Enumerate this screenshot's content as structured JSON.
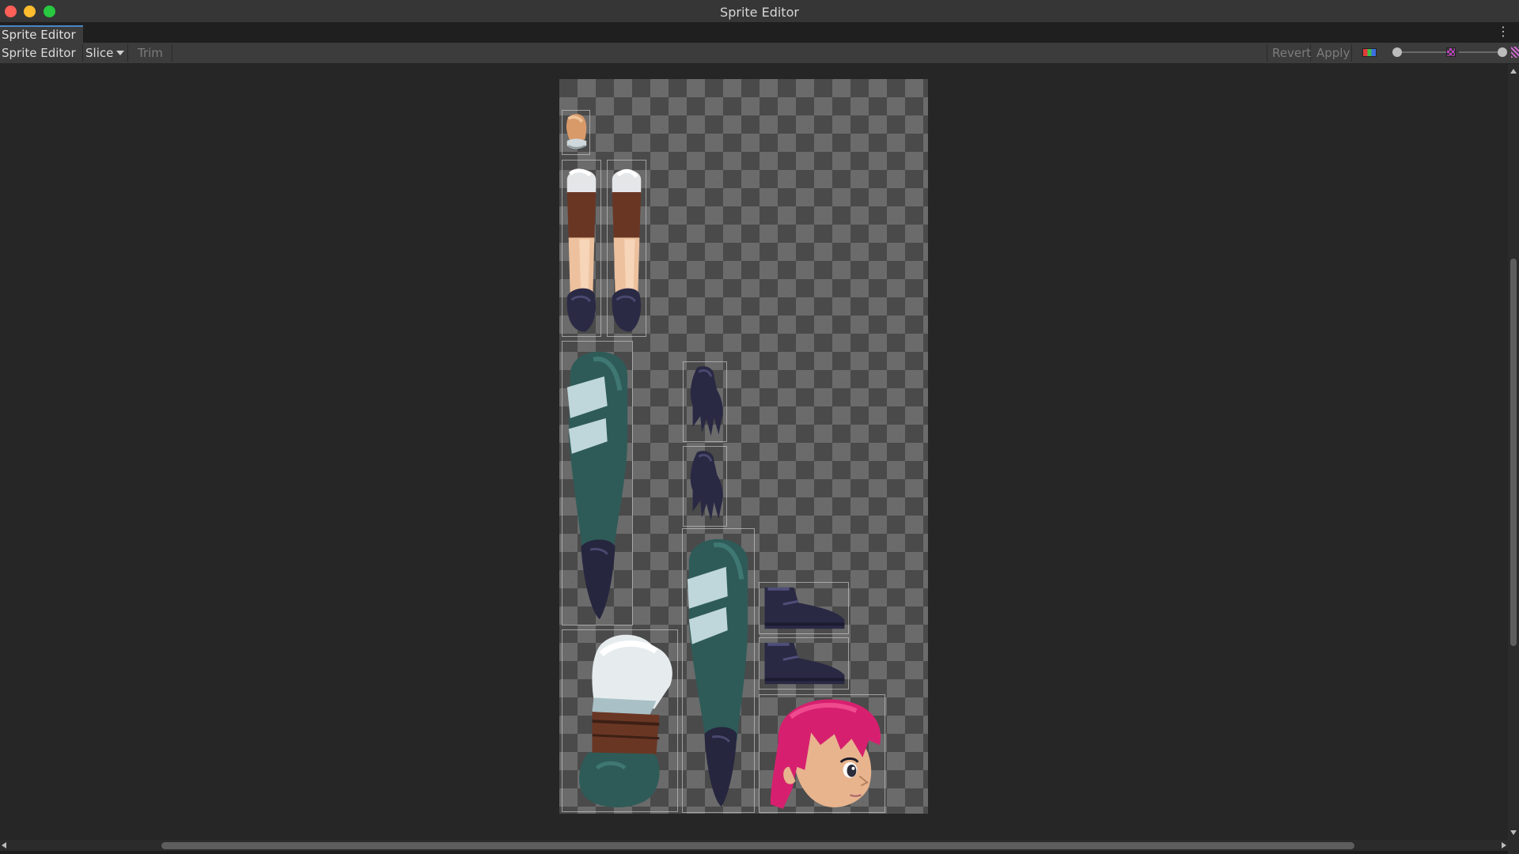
{
  "window": {
    "title": "Sprite Editor",
    "controls": [
      "close-icon",
      "minimize-icon",
      "zoom-icon"
    ]
  },
  "tab": {
    "label": "Sprite Editor",
    "menu_icon": "⋮"
  },
  "toolbar": {
    "mode_dropdown": "Sprite Editor",
    "slice_dropdown": "Slice",
    "trim_label": "Trim",
    "revert_label": "Revert",
    "apply_label": "Apply",
    "icons": [
      "color-channel-icon",
      "mip-level-icon",
      "alpha-toggle-icon"
    ]
  },
  "texture": {
    "background": "checkerboard",
    "sprites": [
      {
        "part": "hand-top"
      },
      {
        "part": "leg-left"
      },
      {
        "part": "leg-right"
      },
      {
        "part": "arm-long-left"
      },
      {
        "part": "glove-upper"
      },
      {
        "part": "glove-lower"
      },
      {
        "part": "arm-long-right"
      },
      {
        "part": "shoe-upper"
      },
      {
        "part": "shoe-lower"
      },
      {
        "part": "torso"
      },
      {
        "part": "head"
      }
    ]
  },
  "colors": {
    "teal": "#2e5b58",
    "stripe": "#bfd6da",
    "glove": "#2a2944",
    "hair": "#d6206f",
    "skin": "#e8b48e",
    "brown": "#5b3322"
  }
}
